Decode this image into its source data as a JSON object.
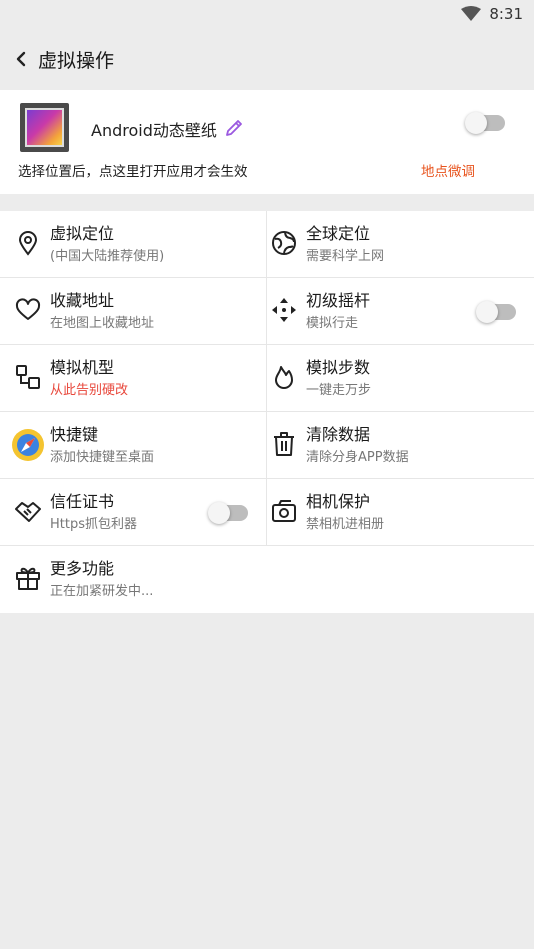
{
  "status": {
    "time": "8:31"
  },
  "appbar": {
    "title": "虚拟操作"
  },
  "wallpaper": {
    "title": "Android动态壁纸",
    "hint": "选择位置后，点这里打开应用才会生效",
    "adjust_label": "地点微调",
    "enabled": false
  },
  "features": [
    {
      "title": "虚拟定位",
      "subtitle": "(中国大陆推荐使用)",
      "icon": "location-pin-icon"
    },
    {
      "title": "全球定位",
      "subtitle": "需要科学上网",
      "icon": "globe-icon"
    },
    {
      "title": "收藏地址",
      "subtitle": "在地图上收藏地址",
      "icon": "heart-icon"
    },
    {
      "title": "初级摇杆",
      "subtitle": "模拟行走",
      "icon": "joystick-arrows-icon",
      "toggle": false
    },
    {
      "title": "模拟机型",
      "subtitle": "从此告别硬改",
      "icon": "device-model-icon",
      "subtitle_color": "#e8473b"
    },
    {
      "title": "模拟步数",
      "subtitle": "一键走万步",
      "icon": "flame-icon"
    },
    {
      "title": "快捷键",
      "subtitle": "添加快捷键至桌面",
      "icon": "shortcut-compass-icon"
    },
    {
      "title": "清除数据",
      "subtitle": "清除分身APP数据",
      "icon": "trash-icon"
    },
    {
      "title": "信任证书",
      "subtitle": "Https抓包利器",
      "icon": "handshake-icon",
      "toggle": false
    },
    {
      "title": "相机保护",
      "subtitle": "禁相机进相册",
      "icon": "camera-icon"
    },
    {
      "title": "更多功能",
      "subtitle": "正在加紧研发中...",
      "icon": "gift-icon"
    }
  ]
}
